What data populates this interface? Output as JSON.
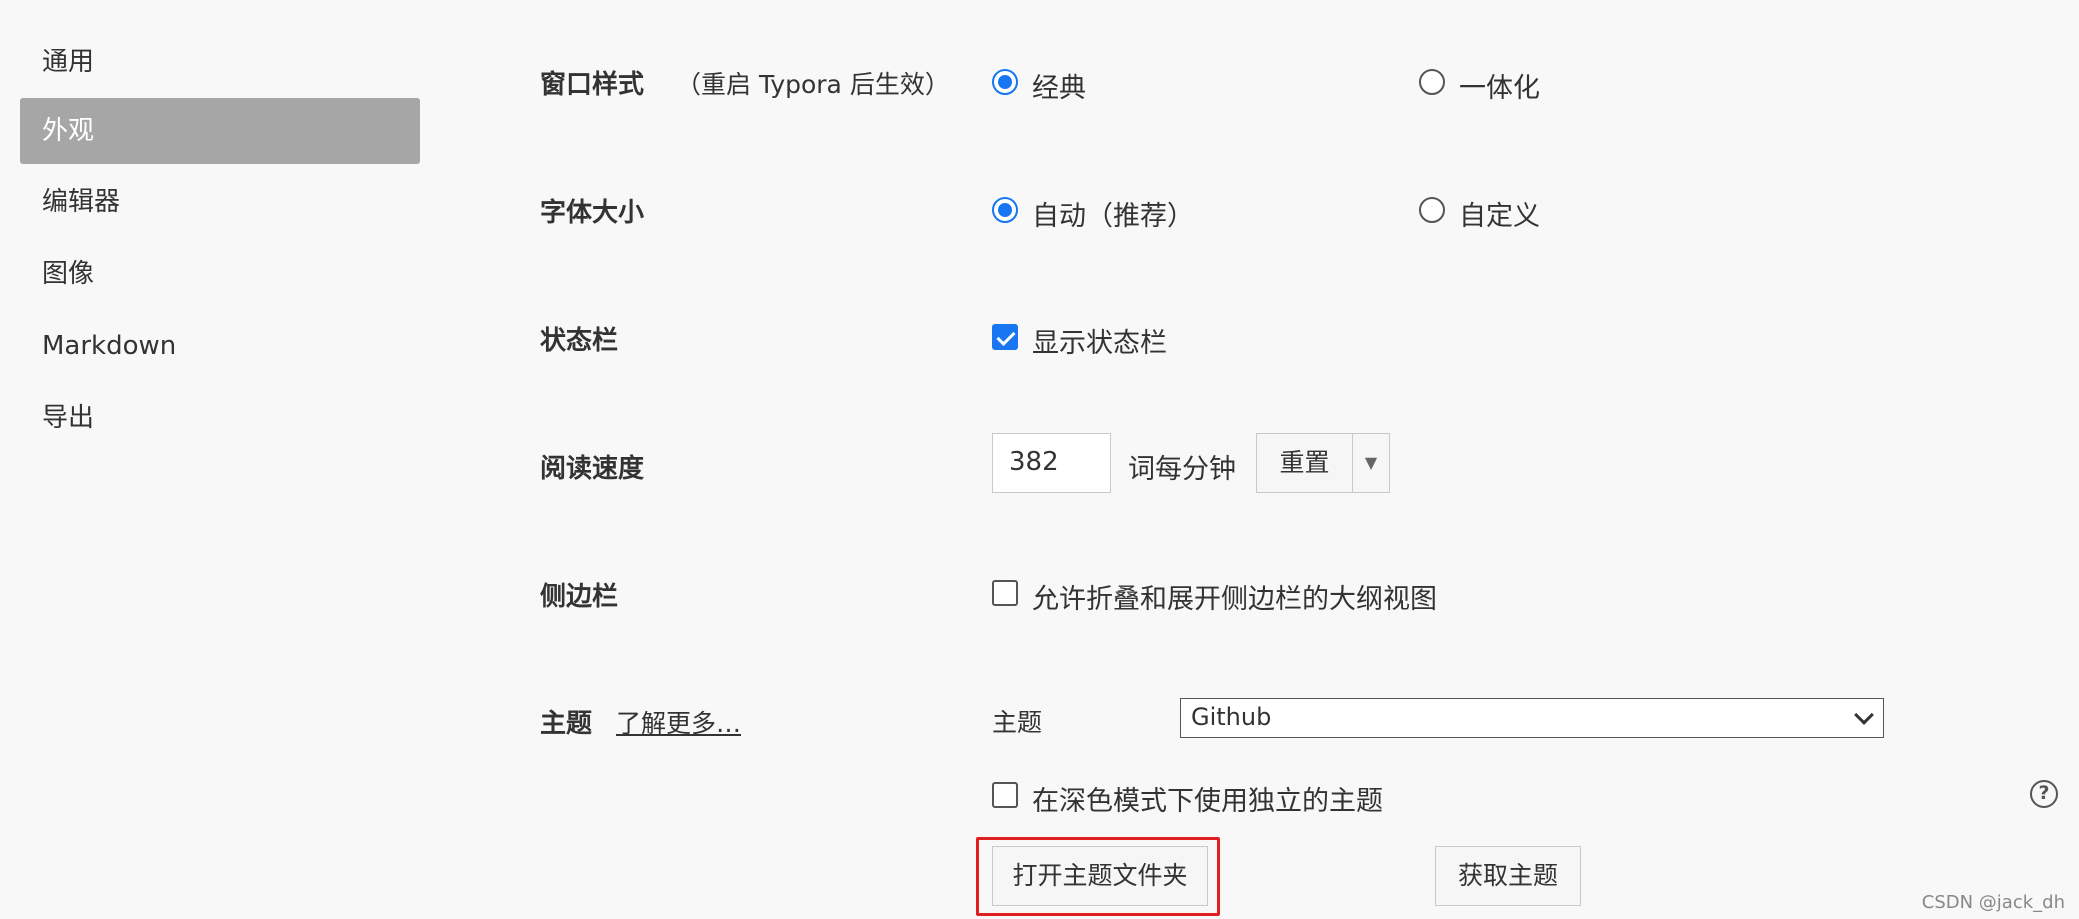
{
  "sidebar": {
    "items": [
      {
        "label": "通用"
      },
      {
        "label": "外观",
        "active": true
      },
      {
        "label": "编辑器"
      },
      {
        "label": "图像"
      },
      {
        "label": "Markdown"
      },
      {
        "label": "导出"
      }
    ]
  },
  "window_style": {
    "label": "窗口样式",
    "hint": "（重启 Typora 后生效）",
    "options": [
      {
        "label": "经典",
        "checked": true
      },
      {
        "label": "一体化",
        "checked": false
      }
    ]
  },
  "font_size": {
    "label": "字体大小",
    "options": [
      {
        "label": "自动（推荐）",
        "checked": true
      },
      {
        "label": "自定义",
        "checked": false
      }
    ]
  },
  "status_bar": {
    "label": "状态栏",
    "checkbox_label": "显示状态栏",
    "checked": true
  },
  "reading_speed": {
    "label": "阅读速度",
    "value": "382",
    "unit": "词每分钟",
    "reset_label": "重置",
    "dropdown_icon": "▼"
  },
  "sidebar_setting": {
    "label": "侧边栏",
    "checkbox_label": "允许折叠和展开侧边栏的大纲视图",
    "checked": false
  },
  "theme": {
    "label": "主题",
    "learn_more": "了解更多…",
    "select_label": "主题",
    "selected": "Github",
    "dark_mode_label": "在深色模式下使用独立的主题",
    "dark_mode_checked": false,
    "help_icon": "?",
    "open_folder_label": "打开主题文件夹",
    "get_themes_label": "获取主题"
  },
  "colors": {
    "accent": "#1976f2",
    "active_nav_bg": "#a6a6a6",
    "highlight": "#e02020"
  },
  "watermark": "CSDN @jack_dh"
}
